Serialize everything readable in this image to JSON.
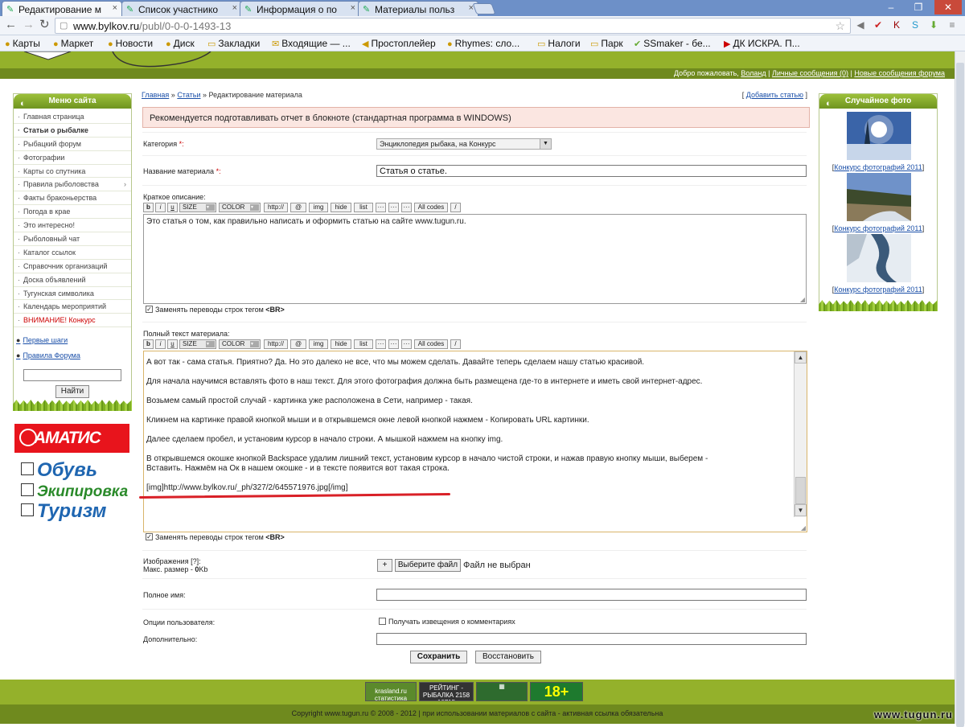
{
  "browser": {
    "tabs": [
      {
        "label": "Редактирование м"
      },
      {
        "label": "Список участнико"
      },
      {
        "label": "Информация о по"
      },
      {
        "label": "Материалы польз"
      }
    ],
    "url_domain": "www.bylkov.ru",
    "url_path": "/publ/0-0-0-1493-13",
    "bookmarks": [
      "Карты",
      "Маркет",
      "Новости",
      "Диск",
      "Закладки",
      "Входящие — ...",
      "Простоплейер",
      "Rhymes: сло...",
      "Налоги",
      "Парк",
      "SSmaker - бе...",
      "ДК ИСКРА. П..."
    ]
  },
  "header": {
    "welcome_prefix": "Добро пожаловать,",
    "user": "Воланд",
    "sep1": "|",
    "messages": "Личные сообщения (0)",
    "sep2": "|",
    "forum_new": "Новые сообщения форума"
  },
  "leftmenu": {
    "title": "Меню сайта",
    "items": [
      {
        "label": "Главная страница"
      },
      {
        "label": "Статьи о рыбалке"
      },
      {
        "label": "Рыбацкий форум"
      },
      {
        "label": "Фотографии"
      },
      {
        "label": "Карты со спутника"
      },
      {
        "label": "Правила рыболовства"
      },
      {
        "label": "Факты браконьерства"
      },
      {
        "label": "Погода в крае"
      },
      {
        "label": "Это интересно!"
      },
      {
        "label": "Рыболовный чат"
      },
      {
        "label": "Каталог ссылок"
      },
      {
        "label": "Справочник организаций"
      },
      {
        "label": "Доска объявлений"
      },
      {
        "label": "Тугунская символика"
      },
      {
        "label": "Календарь мероприятий"
      },
      {
        "label": "ВНИМАНИЕ! Конкурс"
      }
    ],
    "link_first_steps": "Первые шаги",
    "link_forum_rules": "Правила Форума",
    "search_button": "Найти"
  },
  "ads": {
    "amatis": "АМАТИС",
    "line1": "Обувь",
    "line2": "Экипировка",
    "line3": "Туризм"
  },
  "breadcrumb": {
    "home": "Главная",
    "sep": "»",
    "articles": "Статьи",
    "current": "Редактирование материала",
    "add_open": "[",
    "add_link": "Добавить статью",
    "add_close": "]"
  },
  "notice": "Рекомендуется подготавливать отчет в блокноте (стандартная программа в WINDOWS)",
  "form": {
    "category_label": "Категория",
    "required_mark": "*:",
    "category_value": "Энциклопедия рыбака, на Конкурс",
    "title_label": "Название материала",
    "title_value": "Статья о статье.",
    "short_label": "Краткое описание:",
    "toolbar": [
      "b",
      "i",
      "u",
      "SIZE",
      "COLOR",
      "http://",
      "@",
      "img",
      "hide",
      "list",
      "···",
      "···",
      "···",
      "All codes",
      "/"
    ],
    "short_text": "Это статья о том, как правильно написать и оформить статью на сайте www.tugun.ru.",
    "replace_br_label": "Заменять переводы строк тегом",
    "br_tag": "<BR>",
    "full_label": "Полный текст материала:",
    "full_text": [
      "А вот так - сама статья. Приятно? Да. Но это далеко не все, что мы можем сделать. Давайте теперь сделаем нашу статью красивой.",
      "Для начала научимся вставлять фото в наш текст. Для этого фотография должна быть размещена где-то в интернете и иметь свой интернет-адрес.",
      "Возьмем самый простой случай - картинка уже расположена в Сети, например - такая.",
      "Кликнем на картинке правой кнопкой мыши и в открывшемся окне левой кнопкой нажмем  - Копировать URL картинки.",
      "Далее сделаем пробел, и установим курсор в начало строки. А мышкой нажмем на кнопку img.",
      "В открывшемся окошке кнопкой Backspace удалим лишний текст, установим курсор в начало чистой строки, и нажав правую кнопку мыши, выберем -",
      "Вставить. Нажмём на Ок в нашем окошке - и в тексте появится вот такая строка.",
      "[img]http://www.bylkov.ru/_ph/327/2/645571976.jpg[/img]"
    ],
    "images_label": "Изображения [?]:",
    "max_size_label": "Макс. размер - ",
    "max_size_value": "0",
    "max_size_unit": "Kb",
    "plus_button": "+",
    "choose_file_button": "Выберите файл",
    "no_file": "Файл не выбран",
    "fullname_label": "Полное имя:",
    "user_options_label": "Опции пользователя:",
    "notify_label": "Получать извещения о комментариях",
    "extra_label": "Дополнительно:",
    "save_button": "Сохранить",
    "restore_button": "Восстановить"
  },
  "rightpanel": {
    "title": "Случайное фото",
    "photos": [
      {
        "caption_open": "[",
        "caption": "Конкурс фотографий 2011",
        "caption_close": "]"
      },
      {
        "caption_open": "[",
        "caption": "Конкурс фотографий 2011",
        "caption_close": "]"
      },
      {
        "caption_open": "[",
        "caption": "Конкурс фотографий 2011",
        "caption_close": "]"
      }
    ]
  },
  "footer": {
    "counters": [
      "krasland.ru статистика",
      "РЕЙТИНГ - РЫБАЛКА 2158 10715",
      "",
      "18+"
    ],
    "copyright": "Copyright www.tugun.ru © 2008 - 2012 | при использовании материалов с сайта - активная ссылка обязательна",
    "watermark": "www.tugun.ru"
  },
  "colors": {
    "site_green": "#94b12b",
    "dark_green": "#6f8a1e",
    "notice_bg": "#fbe6e1",
    "accent_red": "#d92027"
  }
}
